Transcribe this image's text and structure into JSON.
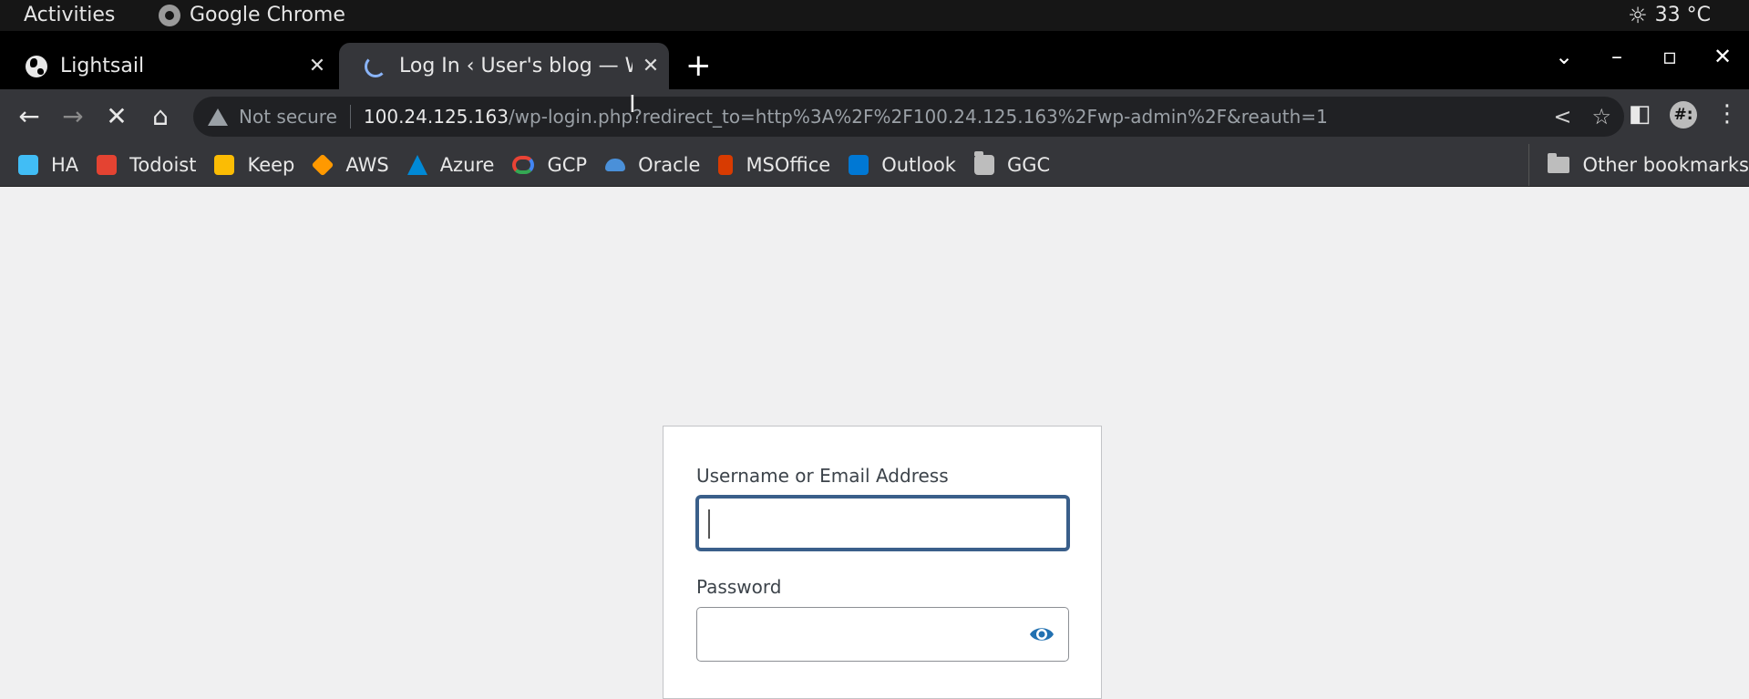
{
  "topbar": {
    "activities": "Activities",
    "app_name": "Google Chrome",
    "weather": "33 °C"
  },
  "tabs": [
    {
      "title": "Lightsail",
      "icon": "globe-icon",
      "active": false
    },
    {
      "title": "Log In ‹ User's blog — Wo",
      "icon": "loading-spinner-icon",
      "active": true
    }
  ],
  "toolbar": {
    "security_label": "Not secure",
    "url_host": "100.24.125.163",
    "url_path": "/wp-login.php?redirect_to=http%3A%2F%2F100.24.125.163%2Fwp-admin%2F&reauth=1",
    "extension_label": "#:"
  },
  "bookmarks": [
    {
      "label": "HA",
      "color": "#41bdf5"
    },
    {
      "label": "Todoist",
      "color": "#e44332"
    },
    {
      "label": "Keep",
      "color": "#fbbc04"
    },
    {
      "label": "AWS",
      "color": "#ff9900"
    },
    {
      "label": "Azure",
      "color": "#0089d6"
    },
    {
      "label": "GCP",
      "color": "#ea4335"
    },
    {
      "label": "Oracle",
      "color": "#4a90d9"
    },
    {
      "label": "MSOffice",
      "color": "#d83b01"
    },
    {
      "label": "Outlook",
      "color": "#0078d4"
    },
    {
      "label": "GGC",
      "color": "#bdbdbd"
    }
  ],
  "other_bookmarks": "Other bookmarks",
  "login": {
    "username_label": "Username or Email Address",
    "username_value": "",
    "password_label": "Password",
    "password_value": ""
  },
  "colors": {
    "page_bg": "#f0f0f1",
    "focus_border": "#3a5f8a",
    "eye_icon": "#2271b1"
  }
}
